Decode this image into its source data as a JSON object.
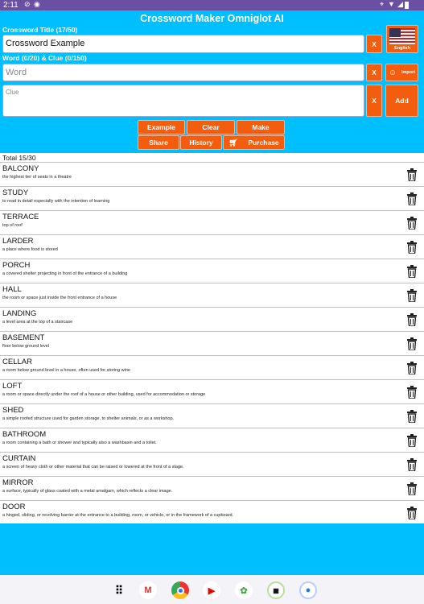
{
  "status_bar": {
    "time": "2:11"
  },
  "app": {
    "title": "Crossword Maker Omniglot AI",
    "accent": "#00bfff",
    "button_color": "#f45c0e"
  },
  "form": {
    "title_label": "Crossword Title (17/50)",
    "title_value": "Crossword Example",
    "word_clue_label": "Word (0/20) & Clue (0/150)",
    "word_placeholder": "Word",
    "clue_placeholder": "Clue",
    "clear_x": "X",
    "language": "English",
    "import": "Import",
    "add": "Add"
  },
  "actions": {
    "example": "Example",
    "clear": "Clear",
    "make": "Make",
    "share": "Share",
    "history": "History",
    "purchase": "Purchase"
  },
  "list": {
    "total": "Total 15/30",
    "items": [
      {
        "word": "BALCONY",
        "clue": "the highest tier of seats in a theatre"
      },
      {
        "word": "STUDY",
        "clue": "to read in detail especially with the intention of learning"
      },
      {
        "word": "TERRACE",
        "clue": "top of roof"
      },
      {
        "word": "LARDER",
        "clue": "a place where food is stored"
      },
      {
        "word": "PORCH",
        "clue": "a covered shelter projecting in front of the entrance of a building"
      },
      {
        "word": "HALL",
        "clue": "the room or space just inside the front entrance of a house"
      },
      {
        "word": "LANDING",
        "clue": "a level area at the top of a staircase"
      },
      {
        "word": "BASEMENT",
        "clue": "floor below ground level"
      },
      {
        "word": "CELLAR",
        "clue": "a room below ground level in a house, often used for storing wine"
      },
      {
        "word": "LOFT",
        "clue": "a room or space directly under the roof of a house or other building, used for accommodation or storage"
      },
      {
        "word": "SHED",
        "clue": "a simple roofed structure used for garden storage, to shelter animals, or as a workshop."
      },
      {
        "word": "BATHROOM",
        "clue": "a room containing a bath or shower and typically also a washbasin and a toilet."
      },
      {
        "word": "CURTAIN",
        "clue": "a screen of heavy cloth or other material that can be raised or lowered at the front of a stage."
      },
      {
        "word": "MIRROR",
        "clue": "a surface, typically of glass coated with a metal amalgam, which reflects a clear image."
      },
      {
        "word": "DOOR",
        "clue": "a hinged, sliding, or revolving barrier at the entrance to a building, room, or vehicle, or in the framework of a cupboard."
      }
    ]
  },
  "dock": {
    "apps": [
      "apps-grid-icon",
      "gmail-icon",
      "chrome-icon",
      "youtube-icon",
      "photos-icon",
      "calendar-app-icon",
      "messages-icon"
    ]
  }
}
